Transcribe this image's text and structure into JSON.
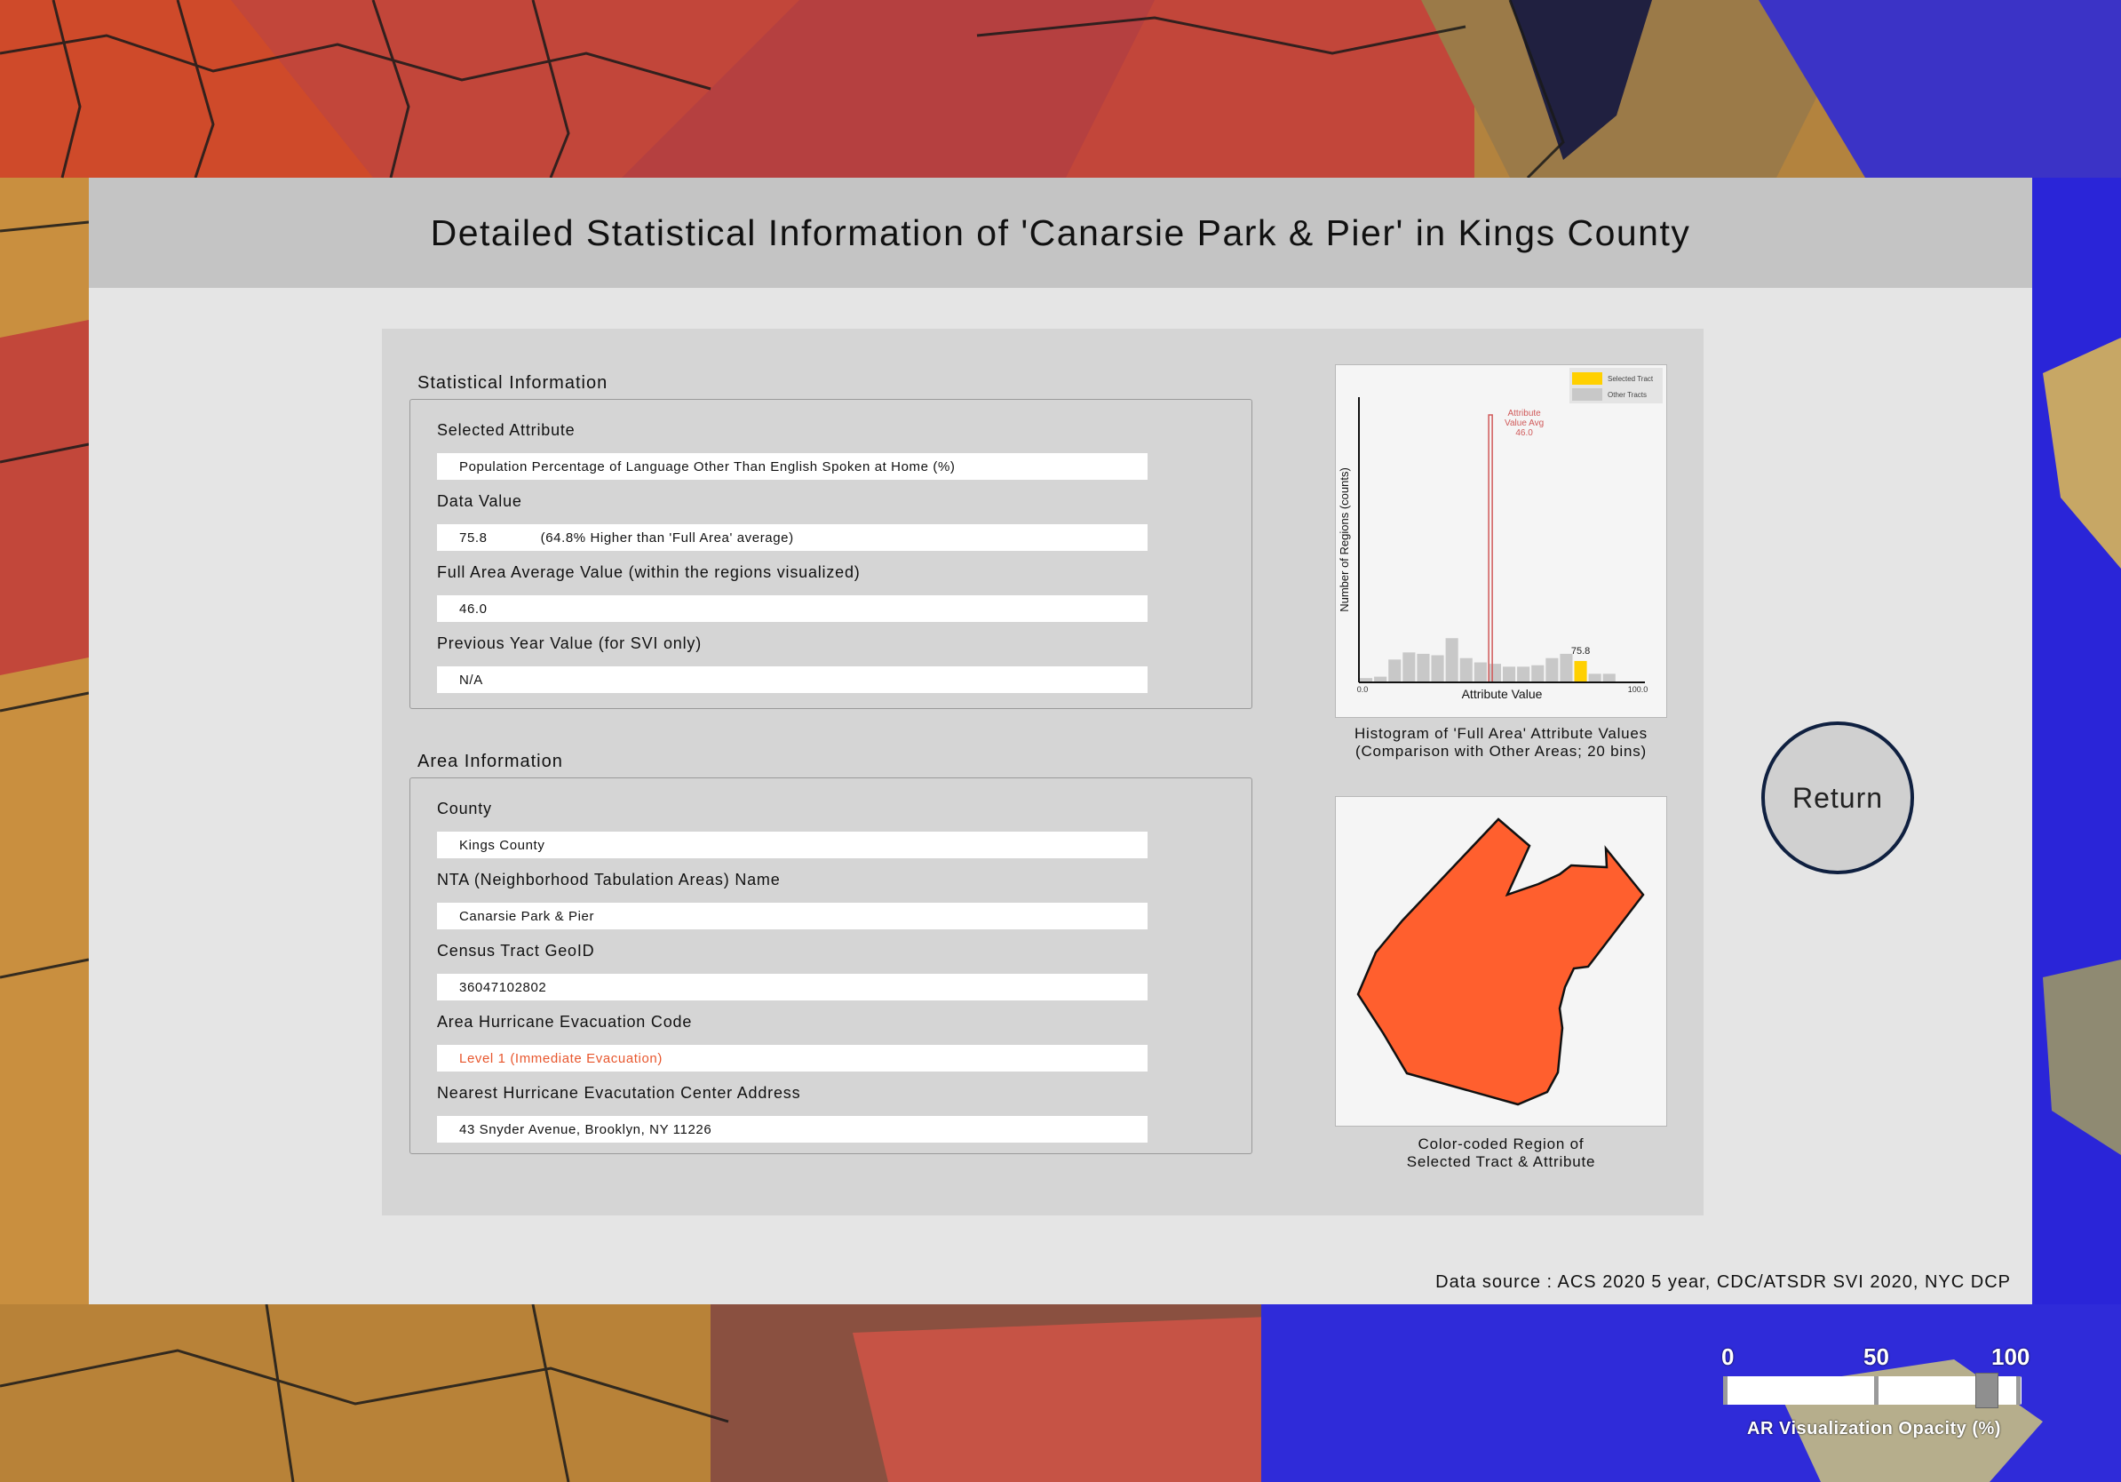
{
  "dialog": {
    "title": "Detailed Statistical Information of 'Canarsie Park & Pier' in Kings County",
    "data_source": "Data source : ACS 2020 5 year, CDC/ATSDR SVI 2020, NYC DCP",
    "return_label": "Return"
  },
  "statistical_info": {
    "section_title": "Statistical Information",
    "selected_attribute_label": "Selected Attribute",
    "selected_attribute_value": "Population Percentage of Language Other Than English Spoken at Home (%)",
    "data_value_label": "Data Value",
    "data_value": "75.8",
    "data_value_note": "(64.8% Higher than 'Full Area' average)",
    "full_avg_label": "Full Area Average Value (within the regions visualized)",
    "full_avg_value": "46.0",
    "prev_year_label": "Previous Year Value (for SVI only)",
    "prev_year_value": "N/A"
  },
  "area_info": {
    "section_title": "Area Information",
    "county_label": "County",
    "county_value": "Kings County",
    "nta_label": "NTA (Neighborhood Tabulation Areas) Name",
    "nta_value": "Canarsie Park & Pier",
    "geoid_label": "Census Tract GeoID",
    "geoid_value": "36047102802",
    "evac_label": "Area Hurricane Evacuation Code",
    "evac_value": "Level 1 (Immediate Evacuation)",
    "evac_color": "#e8572e",
    "center_label": "Nearest Hurricane Evacutation Center Address",
    "center_value": "43 Snyder Avenue, Brooklyn, NY 11226"
  },
  "histogram_caption": {
    "line1": "Histogram of 'Full Area' Attribute Values",
    "line2": "(Comparison with Other Areas; 20 bins)"
  },
  "region_caption": {
    "line1": "Color-coded Region of",
    "line2": "Selected Tract & Attribute"
  },
  "region_color": "#ff5f2e",
  "chart_data": {
    "type": "bar",
    "xlabel": "Attribute Value",
    "ylabel": "Number of Regions (counts)",
    "x_ticks": [
      "0.0",
      "100.0"
    ],
    "xlim": [
      0,
      100
    ],
    "ylim": [
      0,
      20
    ],
    "bins": 20,
    "bin_width": 5,
    "categories": [
      "0-5",
      "5-10",
      "10-15",
      "15-20",
      "20-25",
      "25-30",
      "30-35",
      "35-40",
      "40-45",
      "45-50",
      "50-55",
      "55-60",
      "60-65",
      "65-70",
      "70-75",
      "75-80",
      "80-85",
      "85-90",
      "90-95",
      "95-100"
    ],
    "values": [
      0.3,
      0.4,
      1.6,
      2.1,
      2.0,
      1.9,
      3.1,
      1.7,
      1.4,
      1.3,
      1.1,
      1.1,
      1.2,
      1.7,
      2.0,
      1.5,
      0.6,
      0.6,
      0,
      0
    ],
    "highlight_bin": 15,
    "legend": [
      {
        "label": "Selected Tract",
        "color": "#ffd000"
      },
      {
        "label": "Other Tracts",
        "color": "#c8c8c8"
      }
    ],
    "avg_line": {
      "value": 46.0,
      "label_lines": [
        "Attribute",
        "Value Avg",
        "46.0"
      ],
      "color": "#d05a5a"
    },
    "selected_value": {
      "value": 75.8,
      "label": "75.8"
    },
    "bar_color": "#c8c8c8",
    "highlight_color": "#ffd000"
  },
  "opacity_slider": {
    "label": "AR Visualization Opacity (%)",
    "ticks": [
      "0",
      "50",
      "100"
    ],
    "value": 90
  }
}
